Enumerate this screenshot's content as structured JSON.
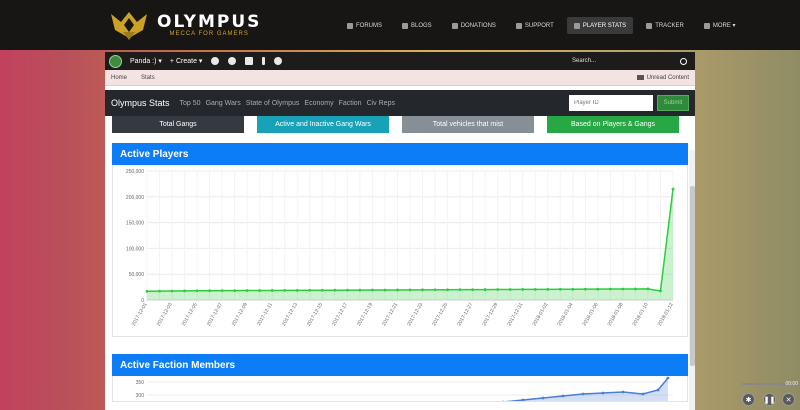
{
  "brand": {
    "name": "OLYMPUS",
    "tagline": "MECCA FOR GAMERS"
  },
  "nav": [
    {
      "label": "FORUMS",
      "icon": "chat-icon",
      "active": false
    },
    {
      "label": "BLOGS",
      "icon": "blog-icon",
      "active": false
    },
    {
      "label": "DONATIONS",
      "icon": "donate-icon",
      "active": false
    },
    {
      "label": "SUPPORT",
      "icon": "support-icon",
      "active": false
    },
    {
      "label": "PLAYER STATS",
      "icon": "stats-icon",
      "active": true
    },
    {
      "label": "TRACKER",
      "icon": "tracker-icon",
      "active": false
    },
    {
      "label": "MORE ▾",
      "icon": "megaphone-icon",
      "active": false
    }
  ],
  "toolbar": {
    "user": "Panda :) ▾",
    "create": "+ Create ▾",
    "search_label": "Search..."
  },
  "breadcrumb": {
    "home": "Home",
    "stats": "Stats",
    "unread": "Unread Content"
  },
  "statsbar": {
    "title": "Olympus Stats",
    "links": [
      "Top 50",
      "Gang Wars",
      "State of Olympus",
      "Economy",
      "Faction",
      "Civ Reps"
    ],
    "player_id_placeholder": "Player ID",
    "submit": "Submit"
  },
  "tabs": [
    {
      "label": "Total Gangs",
      "color": "#343a40"
    },
    {
      "label": "Active and Inactive Gang Wars",
      "color": "#17a2b8"
    },
    {
      "label": "Total vehicles that mist",
      "color": "#868e96"
    },
    {
      "label": "Based on Players & Gangs",
      "color": "#28a745"
    }
  ],
  "cards": {
    "active_players": "Active Players",
    "active_faction": "Active Faction Members"
  },
  "chart_data": [
    {
      "type": "area",
      "title": "Active Players",
      "ylim": [
        0,
        250000
      ],
      "yticks": [
        "0",
        "50,000",
        "100,000",
        "150,000",
        "200,000",
        "250,000"
      ],
      "y_tick_values": [
        0,
        50000,
        100000,
        150000,
        200000,
        250000
      ],
      "x": [
        "2017-12-01",
        "2017-12-02",
        "2017-12-03",
        "2017-12-04",
        "2017-12-05",
        "2017-12-06",
        "2017-12-07",
        "2017-12-08",
        "2017-12-09",
        "2017-12-10",
        "2017-12-11",
        "2017-12-12",
        "2017-12-13",
        "2017-12-14",
        "2017-12-15",
        "2017-12-16",
        "2017-12-17",
        "2017-12-18",
        "2017-12-19",
        "2017-12-20",
        "2017-12-21",
        "2017-12-22",
        "2017-12-23",
        "2017-12-24",
        "2017-12-25",
        "2017-12-26",
        "2017-12-27",
        "2017-12-28",
        "2017-12-29",
        "2017-12-30",
        "2017-12-31",
        "2018-01-01",
        "2018-01-02",
        "2018-01-03",
        "2018-01-04",
        "2018-01-05",
        "2018-01-06",
        "2018-01-07",
        "2018-01-08",
        "2018-01-09",
        "2018-01-10",
        "2018-01-11",
        "2018-01-12"
      ],
      "xtick_labels": [
        "2017-12-01",
        "2017-12-03",
        "2017-12-05",
        "2017-12-07",
        "2017-12-09",
        "2017-12-11",
        "2017-12-13",
        "2017-12-15",
        "2017-12-17",
        "2017-12-19",
        "2017-12-21",
        "2017-12-23",
        "2017-12-25",
        "2017-12-27",
        "2017-12-29",
        "2017-12-31",
        "2018-01-02",
        "2018-01-04",
        "2018-01-06",
        "2018-01-08",
        "2018-01-10",
        "2018-01-12"
      ],
      "values": [
        17000,
        17200,
        17500,
        17700,
        17900,
        18000,
        18100,
        18200,
        18300,
        18400,
        18500,
        18600,
        18700,
        18800,
        18900,
        19000,
        19100,
        19200,
        19300,
        19400,
        19500,
        19600,
        19700,
        19800,
        19900,
        20000,
        20100,
        20200,
        20300,
        20400,
        20500,
        20600,
        20700,
        20800,
        20900,
        21000,
        21100,
        21200,
        21300,
        21400,
        21500,
        17500,
        215000
      ],
      "color": "#2ecc40",
      "grid": true
    },
    {
      "type": "area",
      "title": "Active Faction Members",
      "yticks": [
        "350",
        "300"
      ],
      "color": "#4a7fd6"
    }
  ],
  "media": {
    "time": "00:00"
  }
}
